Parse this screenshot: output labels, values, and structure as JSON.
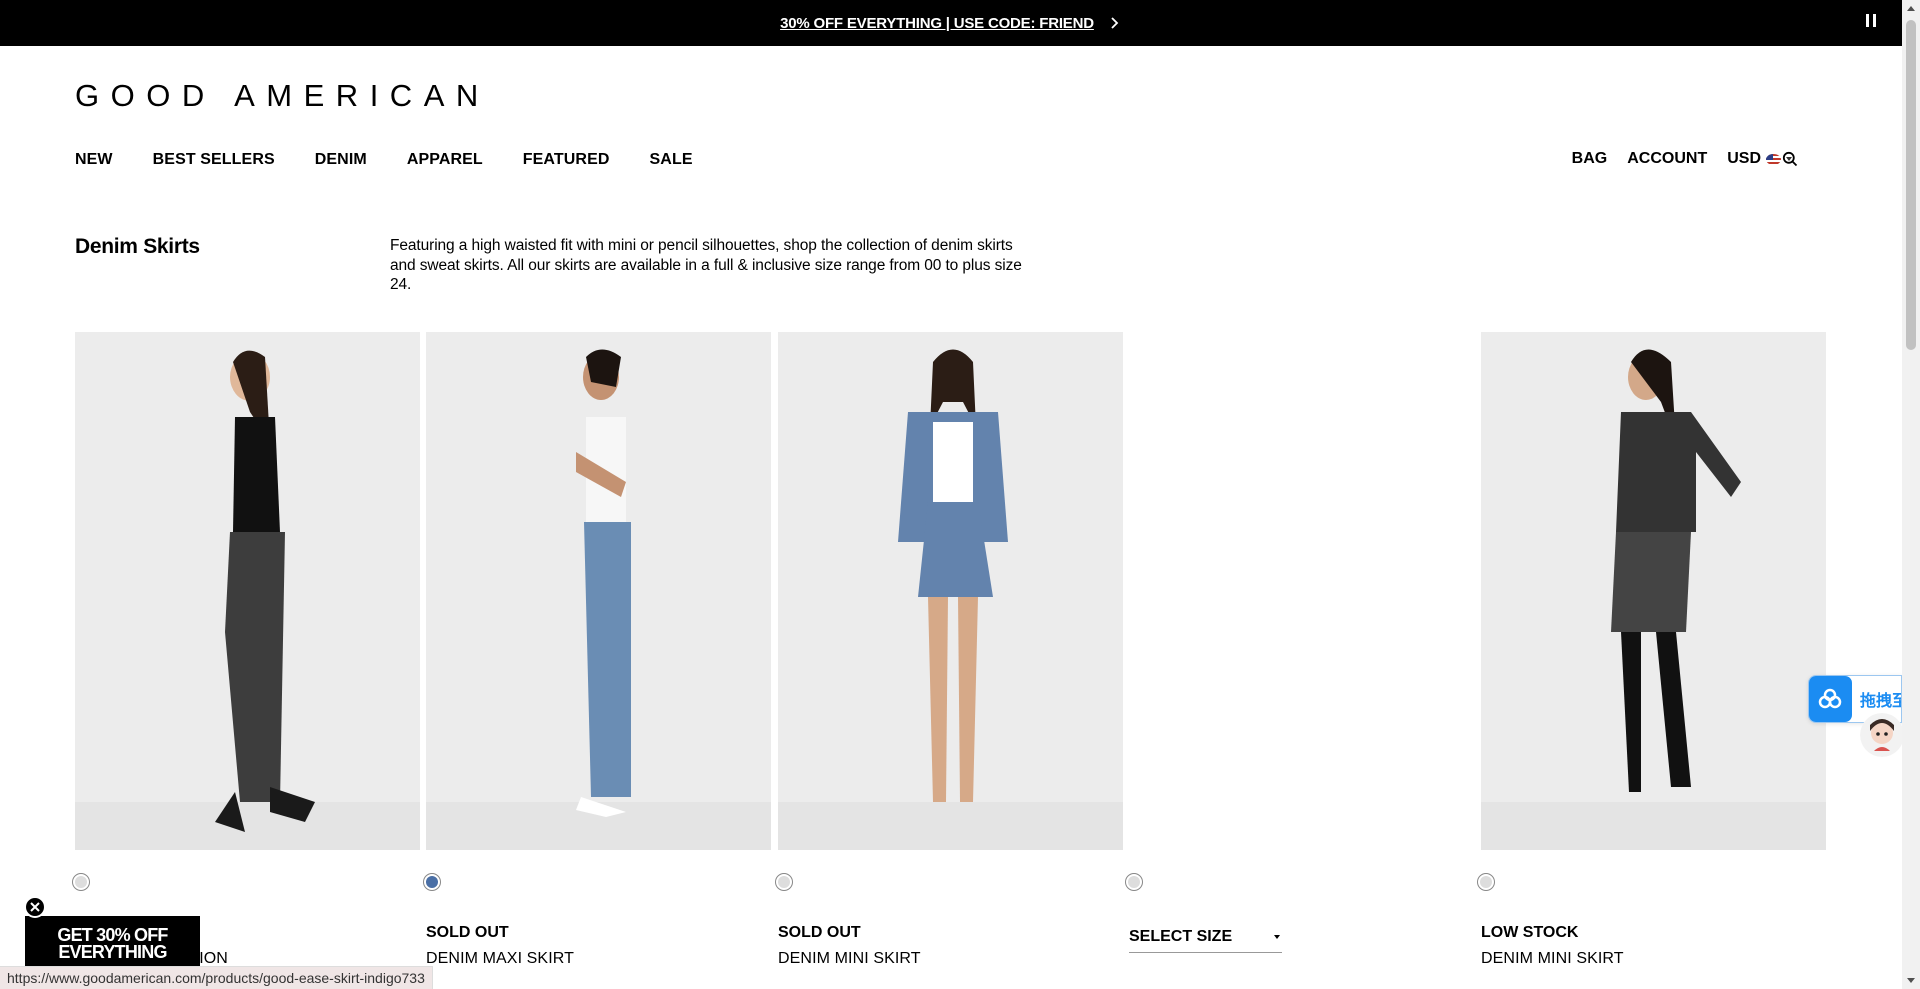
{
  "promo": {
    "text": "30% OFF EVERYTHING | USE CODE: FRIEND"
  },
  "brand": {
    "logo": "GOOD AMERICAN"
  },
  "nav": {
    "items": [
      "NEW",
      "BEST SELLERS",
      "DENIM",
      "APPAREL",
      "FEATURED",
      "SALE"
    ]
  },
  "utility": {
    "bag": "BAG",
    "account": "ACCOUNT",
    "currency": "USD"
  },
  "collection": {
    "title": "Denim Skirts",
    "description": "Featuring a high waisted fit with mini or pencil silhouettes, shop the collection of denim skirts and sweat skirts. All our skirts are available in a full & inclusive size range from 00 to plus size 24."
  },
  "products": [
    {
      "status": "",
      "name": "COMPRESSION",
      "swatch_color": "#d9d9d9",
      "denim_color": "#3d3d3d",
      "top_color": "#111111"
    },
    {
      "status": "SOLD OUT",
      "name": "DENIM MAXI SKIRT",
      "swatch_color": "#4a6fa5",
      "denim_color": "#6a8db4",
      "top_color": "#f7f7f7"
    },
    {
      "status": "SOLD OUT",
      "name": "DENIM MINI SKIRT",
      "swatch_color": "#d9d9d9",
      "denim_color": "#6383ad",
      "top_color": "#ffffff"
    },
    {
      "status": "",
      "name": "",
      "size_select": "SELECT SIZE",
      "swatch_color": "#d9d9d9"
    },
    {
      "status": "LOW STOCK",
      "name": "DENIM MINI SKIRT",
      "swatch_color": "#d9d9d9",
      "denim_color": "#444444",
      "top_color": "#333333"
    }
  ],
  "popup": {
    "line1": "GET 30% OFF",
    "line2": "EVERYTHING"
  },
  "widget": {
    "text": "拖拽至此"
  },
  "status_bar": {
    "url": "https://www.goodamerican.com/products/good-ease-skirt-indigo733"
  }
}
